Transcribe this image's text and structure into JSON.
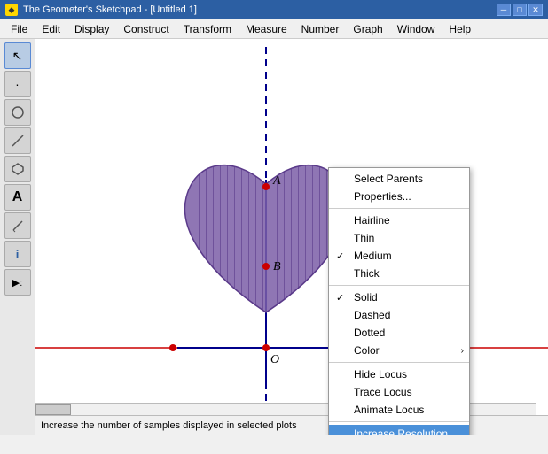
{
  "app": {
    "title": "The Geometer's Sketchpad - [Untitled 1]",
    "icon": "◆"
  },
  "title_controls": {
    "minimize": "─",
    "maximize": "□",
    "close": "✕"
  },
  "menu": {
    "items": [
      "File",
      "Edit",
      "Display",
      "Construct",
      "Transform",
      "Measure",
      "Number",
      "Graph",
      "Window",
      "Help"
    ]
  },
  "toolbar": {
    "tools": [
      {
        "name": "select-tool",
        "icon": "↖",
        "active": true
      },
      {
        "name": "point-tool",
        "icon": "•"
      },
      {
        "name": "compass-tool",
        "icon": "○"
      },
      {
        "name": "line-tool",
        "icon": "╱"
      },
      {
        "name": "polygon-tool",
        "icon": "⬠"
      },
      {
        "name": "text-tool",
        "icon": "A"
      },
      {
        "name": "pencil-tool",
        "icon": "✏"
      },
      {
        "name": "info-tool",
        "icon": "ⓘ"
      },
      {
        "name": "animation-tool",
        "icon": "▶"
      }
    ]
  },
  "context_menu": {
    "items": [
      {
        "id": "select-parents",
        "label": "Select Parents",
        "check": false,
        "arrow": false,
        "separator_after": false
      },
      {
        "id": "properties",
        "label": "Properties...",
        "check": false,
        "arrow": false,
        "separator_after": true
      },
      {
        "id": "hairline",
        "label": "Hairline",
        "check": false,
        "arrow": false,
        "separator_after": false
      },
      {
        "id": "thin",
        "label": "Thin",
        "check": false,
        "arrow": false,
        "separator_after": false
      },
      {
        "id": "medium",
        "label": "Medium",
        "check": true,
        "arrow": false,
        "separator_after": false
      },
      {
        "id": "thick",
        "label": "Thick",
        "check": false,
        "arrow": false,
        "separator_after": true
      },
      {
        "id": "solid",
        "label": "Solid",
        "check": true,
        "arrow": false,
        "separator_after": false
      },
      {
        "id": "dashed",
        "label": "Dashed",
        "check": false,
        "arrow": false,
        "separator_after": false
      },
      {
        "id": "dotted",
        "label": "Dotted",
        "check": false,
        "arrow": false,
        "separator_after": false
      },
      {
        "id": "color",
        "label": "Color",
        "check": false,
        "arrow": true,
        "separator_after": true
      },
      {
        "id": "hide-locus",
        "label": "Hide Locus",
        "check": false,
        "arrow": false,
        "separator_after": false
      },
      {
        "id": "trace-locus",
        "label": "Trace Locus",
        "check": false,
        "arrow": false,
        "separator_after": false
      },
      {
        "id": "animate-locus",
        "label": "Animate Locus",
        "check": false,
        "arrow": false,
        "separator_after": true
      },
      {
        "id": "increase-resolution",
        "label": "Increase Resolution",
        "check": false,
        "arrow": false,
        "highlighted": true,
        "separator_after": false
      }
    ]
  },
  "status_bar": {
    "text": "Increase the number of samples displayed in selected plots"
  },
  "canvas": {
    "axis_color": "#00008b",
    "heart_fill": "#7b5ea7",
    "heart_stroke": "#5a3a8a",
    "stripe_color": "#5a3a8a",
    "point_a_label": "A",
    "point_b_label": "B",
    "point_o_label": "O"
  }
}
